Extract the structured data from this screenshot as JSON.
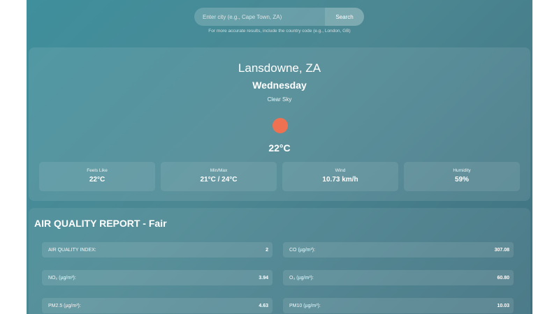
{
  "search": {
    "placeholder": "Enter city (e.g., Cape Town, ZA)",
    "button_label": "Search",
    "hint": "For more accurate results, include the country code (e.g., London, GB)"
  },
  "weather": {
    "city": "Lansdowne, ZA",
    "day": "Wednesday",
    "condition": "Clear Sky",
    "icon": "sun-icon",
    "temperature": "22°C",
    "stats": [
      {
        "label": "Feels Like",
        "value": "22°C"
      },
      {
        "label": "Min/Max",
        "value": "21°C / 24°C"
      },
      {
        "label": "Wind",
        "value": "10.73 km/h"
      },
      {
        "label": "Humidity",
        "value": "59%"
      }
    ]
  },
  "air_quality": {
    "title": "AIR QUALITY REPORT - Fair",
    "items": [
      {
        "label": "AIR QUALITY INDEX:",
        "value": "2"
      },
      {
        "label": "CO (µg/m³):",
        "value": "307.08"
      },
      {
        "label": "NO₂ (µg/m³):",
        "value": "3.94"
      },
      {
        "label": "O₃ (µg/m³):",
        "value": "60.80"
      },
      {
        "label": "PM2.5 (µg/m³):",
        "value": "4.63"
      },
      {
        "label": "PM10 (µg/m³):",
        "value": "10.03"
      }
    ]
  },
  "colors": {
    "background_gradient_start": "#3f8f9c",
    "background_gradient_end": "#3f7180",
    "sun": "#ee7252"
  }
}
